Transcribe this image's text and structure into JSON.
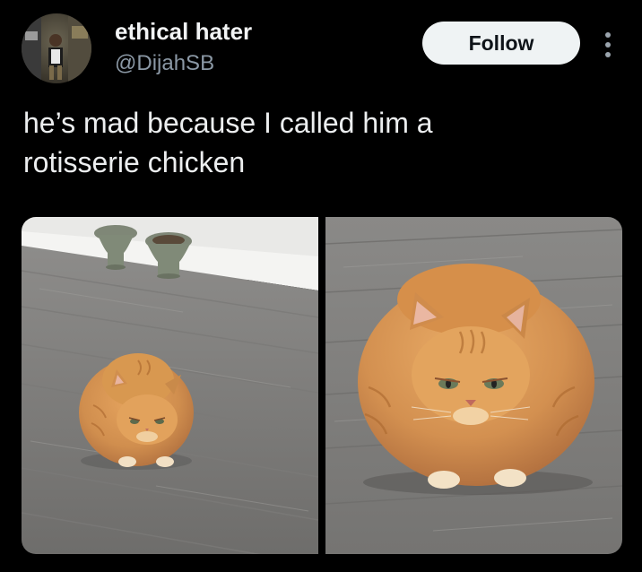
{
  "author": {
    "display_name": "ethical hater",
    "handle": "@DijahSB"
  },
  "actions": {
    "follow_label": "Follow",
    "more_icon": "more-vertical-icon"
  },
  "tweet": {
    "text_lines": [
      "he’s mad because I called him a",
      "rotisserie chicken"
    ]
  },
  "media": [
    {
      "name": "cat-photo-far"
    },
    {
      "name": "cat-photo-close"
    }
  ],
  "colors": {
    "background": "#000000",
    "text_primary": "#e7e9ea",
    "text_secondary": "#8b98a5",
    "follow_button_bg": "#eff3f4",
    "follow_button_text": "#0f1419"
  }
}
